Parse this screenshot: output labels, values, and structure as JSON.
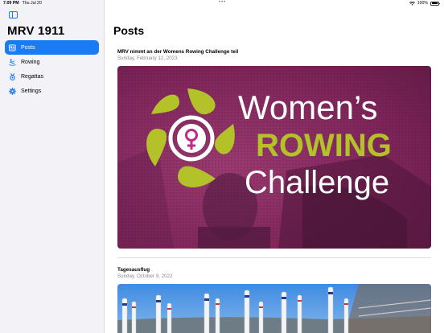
{
  "status_bar": {
    "time": "7:09 PM",
    "date": "Thu Jul 20",
    "battery": "100%"
  },
  "sidebar": {
    "title": "MRV 1911",
    "items": [
      {
        "label": "Posts",
        "icon": "newspaper-icon",
        "active": true
      },
      {
        "label": "Rowing",
        "icon": "rowing-icon",
        "active": false
      },
      {
        "label": "Regattas",
        "icon": "medal-icon",
        "active": false
      },
      {
        "label": "Settings",
        "icon": "gear-icon",
        "active": false
      }
    ]
  },
  "main": {
    "title": "Posts",
    "posts": [
      {
        "title": "MRV nimmt an der Womens Rowing Challenge teil",
        "date": "Sunday, February 12, 2023",
        "image_text": {
          "line1": "Women’s",
          "line2": "ROWING",
          "line3": "Challenge"
        }
      },
      {
        "title": "Tagesausflug",
        "date": "Sunday, October 9, 2022"
      }
    ]
  },
  "colors": {
    "accent": "#1a7cf5",
    "sidebar_bg": "#f2f2f7",
    "banner_magenta": "#8a2b63",
    "banner_green": "#b4c22a"
  }
}
